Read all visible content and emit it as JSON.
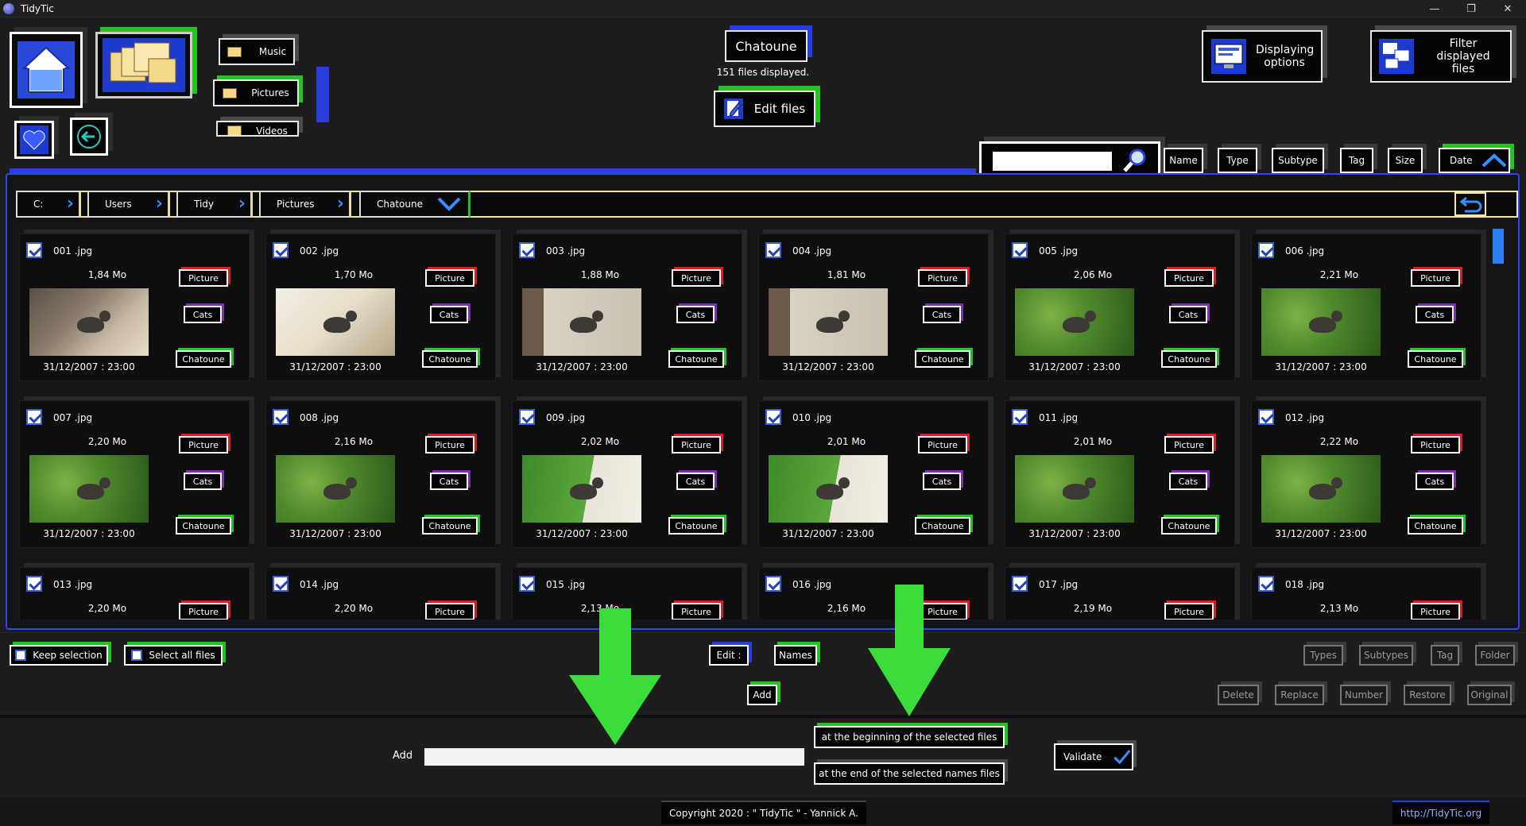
{
  "window": {
    "title": "TidyTic",
    "minimize": "—",
    "restore": "❐",
    "close": "✕"
  },
  "nav": {
    "music": "Music",
    "pictures": "Pictures",
    "videos": "Videos"
  },
  "header": {
    "folder_title": "Chatoune",
    "files_displayed": "151 files displayed.",
    "edit_files": "Edit files"
  },
  "top_right": {
    "displaying_options": "Displaying options",
    "filter_files": "Filter displayed files"
  },
  "sort": {
    "name": "Name",
    "type": "Type",
    "subtype": "Subtype",
    "tag": "Tag",
    "size": "Size",
    "date": "Date"
  },
  "search": {
    "value": ""
  },
  "breadcrumb": [
    "C:",
    "Users",
    "Tidy",
    "Pictures",
    "Chatoune"
  ],
  "files": [
    {
      "name": "001 .jpg",
      "size": "1,84 Mo",
      "date": "31/12/2007 : 23:00",
      "type": "Picture",
      "subtype": "Cats",
      "tag": "Chatoune",
      "scene": "wall"
    },
    {
      "name": "002 .jpg",
      "size": "1,70 Mo",
      "date": "31/12/2007 : 23:00",
      "type": "Picture",
      "subtype": "Cats",
      "tag": "Chatoune",
      "scene": "bright"
    },
    {
      "name": "003 .jpg",
      "size": "1,88 Mo",
      "date": "31/12/2007 : 23:00",
      "type": "Picture",
      "subtype": "Cats",
      "tag": "Chatoune",
      "scene": "pavement"
    },
    {
      "name": "004 .jpg",
      "size": "1,81 Mo",
      "date": "31/12/2007 : 23:00",
      "type": "Picture",
      "subtype": "Cats",
      "tag": "Chatoune",
      "scene": "pavement"
    },
    {
      "name": "005 .jpg",
      "size": "2,06 Mo",
      "date": "31/12/2007 : 23:00",
      "type": "Picture",
      "subtype": "Cats",
      "tag": "Chatoune",
      "scene": "grass"
    },
    {
      "name": "006 .jpg",
      "size": "2,21 Mo",
      "date": "31/12/2007 : 23:00",
      "type": "Picture",
      "subtype": "Cats",
      "tag": "Chatoune",
      "scene": "grass"
    },
    {
      "name": "007 .jpg",
      "size": "2,20 Mo",
      "date": "31/12/2007 : 23:00",
      "type": "Picture",
      "subtype": "Cats",
      "tag": "Chatoune",
      "scene": "grass"
    },
    {
      "name": "008 .jpg",
      "size": "2,16 Mo",
      "date": "31/12/2007 : 23:00",
      "type": "Picture",
      "subtype": "Cats",
      "tag": "Chatoune",
      "scene": "grass"
    },
    {
      "name": "009 .jpg",
      "size": "2,02 Mo",
      "date": "31/12/2007 : 23:00",
      "type": "Picture",
      "subtype": "Cats",
      "tag": "Chatoune",
      "scene": "path"
    },
    {
      "name": "010 .jpg",
      "size": "2,01 Mo",
      "date": "31/12/2007 : 23:00",
      "type": "Picture",
      "subtype": "Cats",
      "tag": "Chatoune",
      "scene": "path"
    },
    {
      "name": "011 .jpg",
      "size": "2,01 Mo",
      "date": "31/12/2007 : 23:00",
      "type": "Picture",
      "subtype": "Cats",
      "tag": "Chatoune",
      "scene": "grass"
    },
    {
      "name": "012 .jpg",
      "size": "2,22 Mo",
      "date": "31/12/2007 : 23:00",
      "type": "Picture",
      "subtype": "Cats",
      "tag": "Chatoune",
      "scene": "grass"
    },
    {
      "name": "013 .jpg",
      "size": "2,20 Mo",
      "date": "",
      "type": "Picture",
      "subtype": "",
      "tag": "",
      "scene": "none"
    },
    {
      "name": "014 .jpg",
      "size": "2,20 Mo",
      "date": "",
      "type": "Picture",
      "subtype": "",
      "tag": "",
      "scene": "none"
    },
    {
      "name": "015 .jpg",
      "size": "2,13 Mo",
      "date": "",
      "type": "Picture",
      "subtype": "",
      "tag": "",
      "scene": "none"
    },
    {
      "name": "016 .jpg",
      "size": "2,16 Mo",
      "date": "",
      "type": "Picture",
      "subtype": "",
      "tag": "",
      "scene": "none"
    },
    {
      "name": "017 .jpg",
      "size": "2,19 Mo",
      "date": "",
      "type": "Picture",
      "subtype": "",
      "tag": "",
      "scene": "none"
    },
    {
      "name": "018 .jpg",
      "size": "2,13 Mo",
      "date": "",
      "type": "Picture",
      "subtype": "",
      "tag": "",
      "scene": "none"
    }
  ],
  "bottom": {
    "keep_selection": "Keep selection",
    "select_all": "Select all files",
    "edit_label": "Edit :",
    "names": "Names",
    "add": "Add",
    "types": "Types",
    "subtypes": "Subtypes",
    "tag": "Tag",
    "folder": "Folder",
    "delete": "Delete",
    "replace": "Replace",
    "number": "Number",
    "restore": "Restore",
    "original": "Original",
    "add_label": "Add",
    "add_input_value": "",
    "at_beginning": "at the beginning of the selected files",
    "at_end": "at the end of the selected names files",
    "validate": "Validate"
  },
  "footer": {
    "copyright": "Copyright 2020 : \" TidyTic \" - Yannick A.",
    "url": "http://TidyTic.org"
  },
  "colors": {
    "accent_blue": "#2a3ee0",
    "accent_green": "#22c322",
    "accent_red": "#d42020",
    "annotation_arrow": "#3ddc3d"
  }
}
